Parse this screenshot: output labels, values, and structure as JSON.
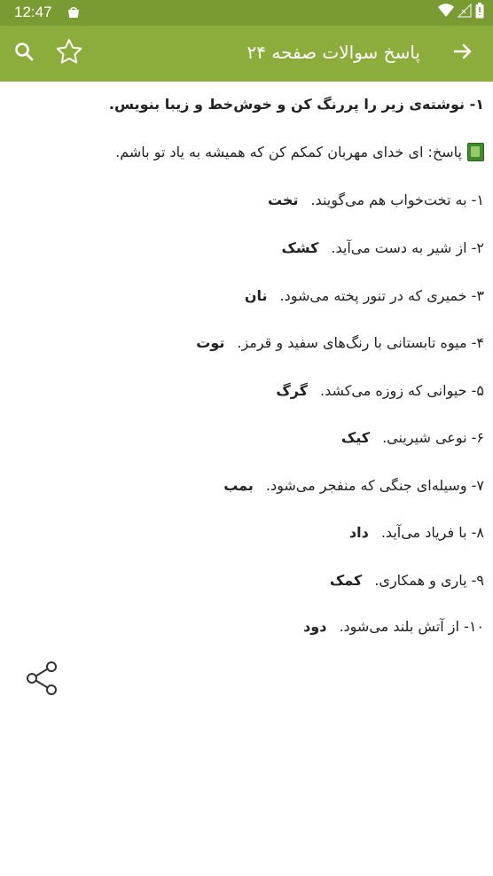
{
  "status_bar": {
    "time": "12:47",
    "icons": [
      "shopping-bag-icon",
      "wifi-icon",
      "signal-icon",
      "battery-icon"
    ]
  },
  "app_bar": {
    "title": "پاسخ سوالات صفحه ۲۴",
    "back_icon": "arrow-right-icon",
    "favorite_icon": "star-outline-icon",
    "search_icon": "search-icon",
    "color": "#8cad3c"
  },
  "content": {
    "heading": "۱- نوشته‌ی زیر را پررنگ کن و خوش‌خط و زیبا بنویس.",
    "answer": "پاسخ: ای خدای مهربان کمکم کن که همیشه به یاد تو باشم.",
    "items": [
      {
        "question": "۱- به تخت‌خواب هم می‌گویند.",
        "answer": "تخت"
      },
      {
        "question": "۲- از شیر به دست می‌آید.",
        "answer": "کشک"
      },
      {
        "question": "۳- خمیری که در تنور پخته می‌شود.",
        "answer": "نان"
      },
      {
        "question": "۴- میوه تابستانی با رنگ‌های سفید و قرمز.",
        "answer": "توت"
      },
      {
        "question": "۵- حیوانی که زوزه می‌کشد.",
        "answer": "گرگ"
      },
      {
        "question": "۶- نوعی شیرینی.",
        "answer": "کیک"
      },
      {
        "question": "۷- وسیله‌ای جنگی که منفجر می‌شود.",
        "answer": "بمب"
      },
      {
        "question": "۸- با فریاد می‌آید.",
        "answer": "داد"
      },
      {
        "question": "۹- یاری و همکاری.",
        "answer": "کمک"
      },
      {
        "question": "۱۰- از آتش بلند می‌شود.",
        "answer": "دود"
      }
    ]
  },
  "share_icon": "share-icon"
}
